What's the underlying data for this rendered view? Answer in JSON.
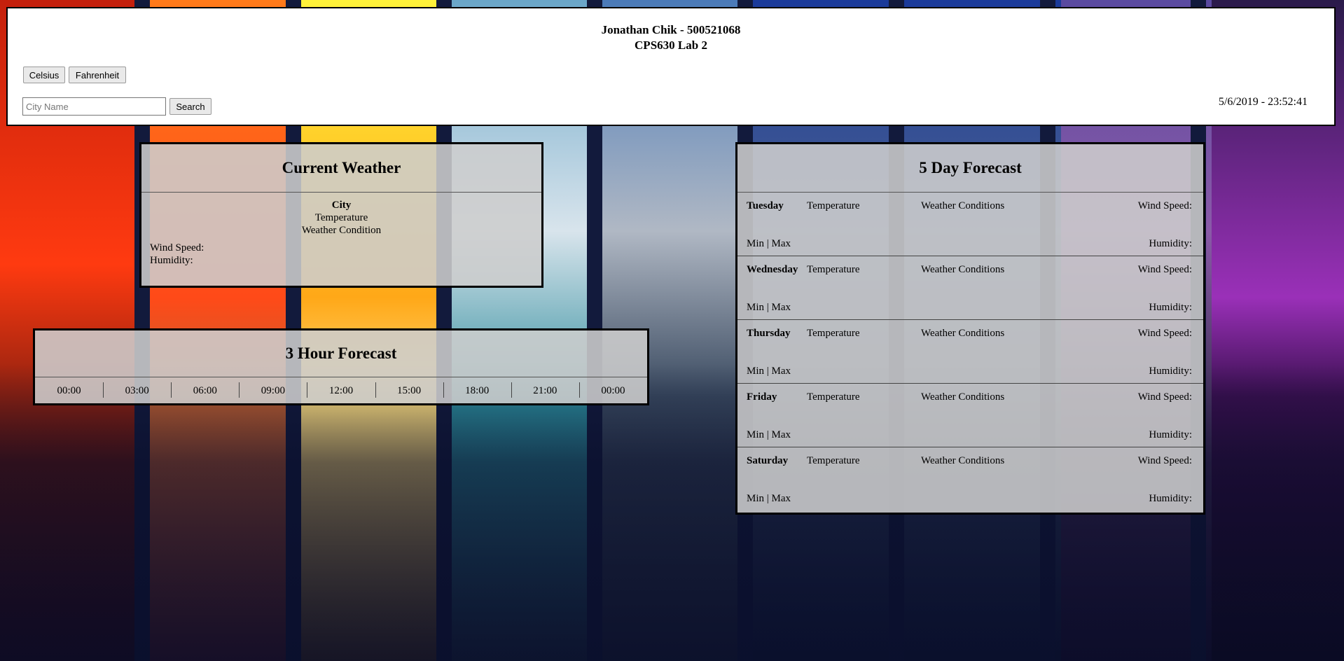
{
  "background": {
    "colors": [
      "#e8340f",
      "#ff5a1a",
      "#1a2448",
      "#f7b21a",
      "#6aa6c8",
      "#8b9cb4",
      "#1d3c8c",
      "#2a4a9a",
      "#7a3a8c",
      "#3b1a5c"
    ]
  },
  "header": {
    "title_line1": "Jonathan Chik - 500521068",
    "title_line2": "CPS630 Lab 2",
    "celsius_label": "Celsius",
    "fahrenheit_label": "Fahrenheit",
    "search_placeholder": "City Name",
    "search_value": "",
    "search_label": "Search",
    "datetime": "5/6/2019 - 23:52:41"
  },
  "current": {
    "title": "Current Weather",
    "city": "City",
    "temperature": "Temperature",
    "condition": "Weather Condition",
    "wind_label": "Wind Speed:",
    "humidity_label": "Humidity:"
  },
  "hourly": {
    "title": "3 Hour Forecast",
    "hours": [
      "00:00",
      "03:00",
      "06:00",
      "09:00",
      "12:00",
      "15:00",
      "18:00",
      "21:00",
      "00:00"
    ]
  },
  "daily": {
    "title": "5 Day Forecast",
    "days": [
      {
        "name": "Tuesday",
        "temperature": "Temperature",
        "conditions": "Weather Conditions",
        "wind": "Wind Speed:",
        "minmax": "Min | Max",
        "humidity": "Humidity:"
      },
      {
        "name": "Wednesday",
        "temperature": "Temperature",
        "conditions": "Weather Conditions",
        "wind": "Wind Speed:",
        "minmax": "Min | Max",
        "humidity": "Humidity:"
      },
      {
        "name": "Thursday",
        "temperature": "Temperature",
        "conditions": "Weather Conditions",
        "wind": "Wind Speed:",
        "minmax": "Min | Max",
        "humidity": "Humidity:"
      },
      {
        "name": "Friday",
        "temperature": "Temperature",
        "conditions": "Weather Conditions",
        "wind": "Wind Speed:",
        "minmax": "Min | Max",
        "humidity": "Humidity:"
      },
      {
        "name": "Saturday",
        "temperature": "Temperature",
        "conditions": "Weather Conditions",
        "wind": "Wind Speed:",
        "minmax": "Min | Max",
        "humidity": "Humidity:"
      }
    ]
  }
}
